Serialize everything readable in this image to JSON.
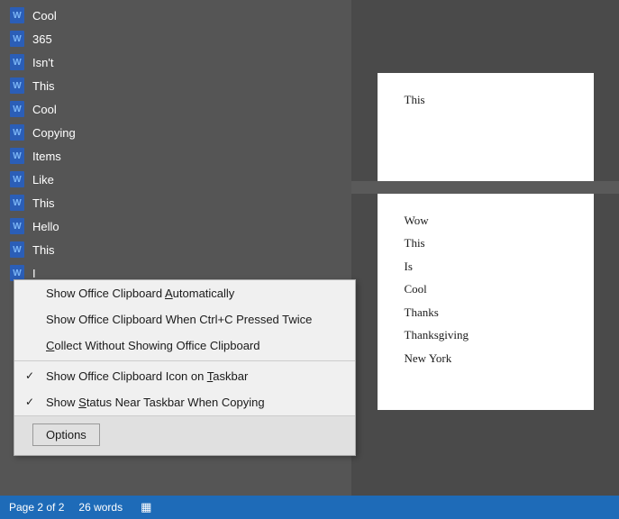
{
  "sidebar": {
    "items": [
      {
        "label": "Cool",
        "icon": "word-icon"
      },
      {
        "label": "365",
        "icon": "word-icon"
      },
      {
        "label": "Isn't",
        "icon": "word-icon"
      },
      {
        "label": "This",
        "icon": "word-icon"
      },
      {
        "label": "Cool",
        "icon": "word-icon"
      },
      {
        "label": "Copying",
        "icon": "word-icon"
      },
      {
        "label": "Items",
        "icon": "word-icon"
      },
      {
        "label": "Like",
        "icon": "word-icon"
      },
      {
        "label": "This",
        "icon": "word-icon"
      },
      {
        "label": "Hello",
        "icon": "word-icon"
      },
      {
        "label": "This",
        "icon": "word-icon"
      },
      {
        "label": "I",
        "icon": "word-icon"
      }
    ]
  },
  "context_menu": {
    "items": [
      {
        "label": "Show Office Clipboard ",
        "underline_char": "A",
        "label_after": "utomatically",
        "checked": false
      },
      {
        "label": "Show Office Clipboard When Ctrl+C Pressed Twice",
        "checked": false
      },
      {
        "label": "",
        "underline_char": "C",
        "label_prefix": "",
        "label_text": "ollect Without Showing Office Clipboard",
        "checked": false
      },
      {
        "label": "Show Office Clipboard Icon on ",
        "underline_char": "T",
        "label_after": "askbar",
        "checked": true
      },
      {
        "label": "Show ",
        "underline_char": "S",
        "label_after": "tatus Near Taskbar When Copying",
        "checked": true
      }
    ],
    "options_btn": "Options"
  },
  "doc": {
    "page1_lines": [
      "This"
    ],
    "page2_lines": [
      "Wow",
      "This",
      "Is",
      "Cool",
      "Thanks",
      "Thanksgiving",
      "New York"
    ]
  },
  "status_bar": {
    "page_info": "Page 2 of 2",
    "word_count": "26 words"
  }
}
